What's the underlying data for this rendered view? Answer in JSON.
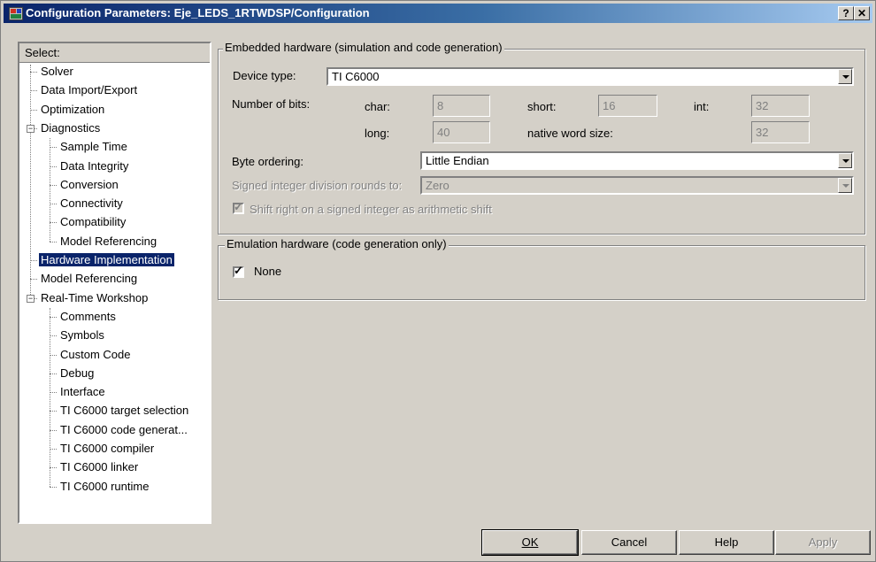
{
  "window": {
    "title": "Configuration Parameters: Eje_LEDS_1RTWDSP/Configuration",
    "help_glyph": "?",
    "close_glyph": "✕"
  },
  "tree": {
    "header": "Select:",
    "items": [
      {
        "label": "Solver"
      },
      {
        "label": "Data Import/Export"
      },
      {
        "label": "Optimization"
      },
      {
        "label": "Diagnostics"
      },
      {
        "label": "Sample Time"
      },
      {
        "label": "Data Integrity"
      },
      {
        "label": "Conversion"
      },
      {
        "label": "Connectivity"
      },
      {
        "label": "Compatibility"
      },
      {
        "label": "Model Referencing"
      },
      {
        "label": "Hardware Implementation",
        "selected": true
      },
      {
        "label": "Model Referencing"
      },
      {
        "label": "Real-Time Workshop"
      },
      {
        "label": "Comments"
      },
      {
        "label": "Symbols"
      },
      {
        "label": "Custom Code"
      },
      {
        "label": "Debug"
      },
      {
        "label": "Interface"
      },
      {
        "label": "TI C6000 target selection"
      },
      {
        "label": "TI C6000 code generat..."
      },
      {
        "label": "TI C6000 compiler"
      },
      {
        "label": "TI C6000 linker"
      },
      {
        "label": "TI C6000 runtime"
      }
    ],
    "expander_glyph": "−"
  },
  "embedded": {
    "legend": "Embedded hardware (simulation and code generation)",
    "device_type_label": "Device type:",
    "device_type_value": "TI C6000",
    "num_bits_label": "Number of bits:",
    "char_label": "char:",
    "char_value": "8",
    "short_label": "short:",
    "short_value": "16",
    "int_label": "int:",
    "int_value": "32",
    "long_label": "long:",
    "long_value": "40",
    "native_label": "native word size:",
    "native_value": "32",
    "byte_ordering_label": "Byte ordering:",
    "byte_ordering_value": "Little Endian",
    "signed_div_label": "Signed integer division rounds to:",
    "signed_div_value": "Zero",
    "shift_right_label": "Shift right on a signed integer as arithmetic shift",
    "shift_right_checked": true
  },
  "emulation": {
    "legend": "Emulation hardware (code generation only)",
    "none_label": "None",
    "none_checked": true
  },
  "buttons": {
    "ok": "OK",
    "cancel": "Cancel",
    "help": "Help",
    "apply": "Apply"
  },
  "check_glyph": "✓"
}
